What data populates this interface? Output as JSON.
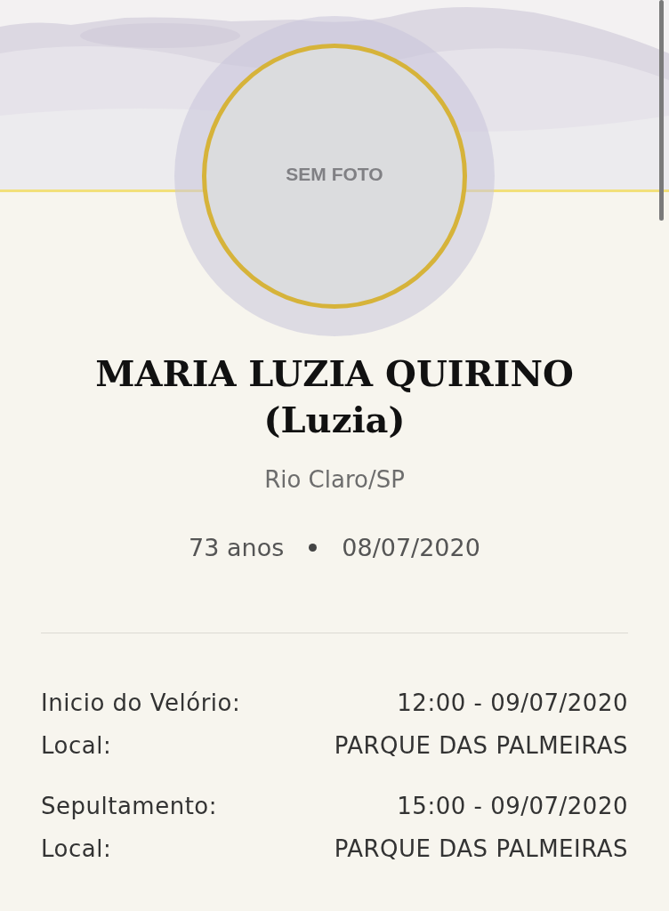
{
  "avatar": {
    "placeholder_text": "SEM FOTO"
  },
  "name": "MARIA LUZIA QUIRINO (Luzia)",
  "location": "Rio Claro/SP",
  "age": "73 anos",
  "date": "08/07/2020",
  "events": [
    {
      "label": "Inicio do Velório:",
      "value": "12:00 - 09/07/2020",
      "place_label": "Local:",
      "place": "PARQUE DAS PALMEIRAS"
    },
    {
      "label": "Sepultamento:",
      "value": "15:00 - 09/07/2020",
      "place_label": "Local:",
      "place": "PARQUE DAS PALMEIRAS"
    }
  ]
}
